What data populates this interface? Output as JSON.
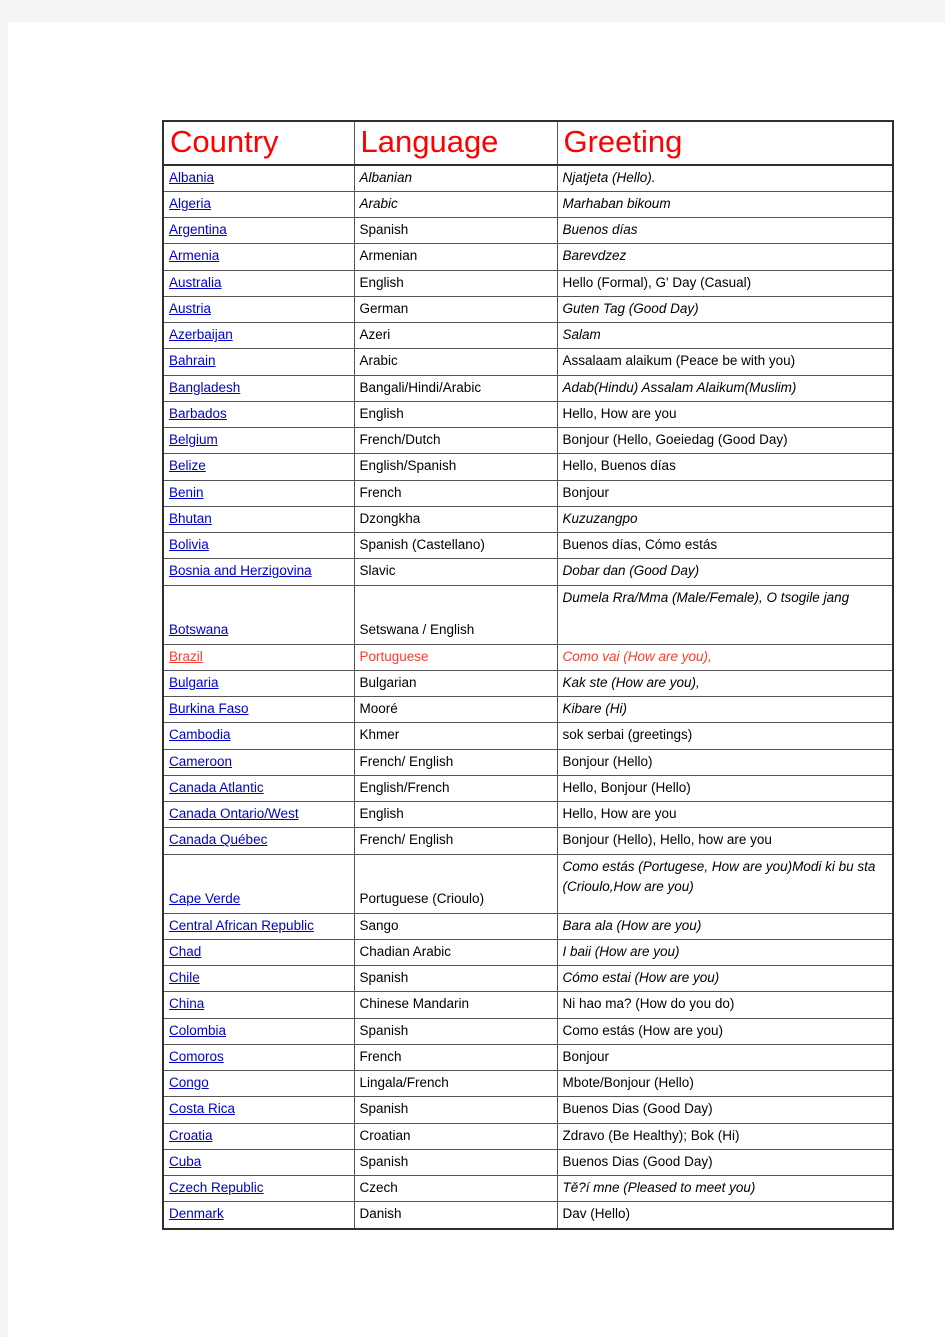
{
  "document": {
    "table": {
      "headers": {
        "country": "Country",
        "language": "Language",
        "greeting": "Greeting"
      },
      "header_color": "#ff0000",
      "link_color": "#0000cc",
      "highlight_color": "#ff3b30",
      "rows": [
        {
          "country": "Albania",
          "language": "Albanian",
          "greeting": "Njatjeta (Hello).",
          "language_italic": true,
          "greeting_italic": true,
          "highlight": false
        },
        {
          "country": "Algeria",
          "language": "Arabic",
          "greeting": "Marhaban bikoum",
          "language_italic": true,
          "greeting_italic": true,
          "highlight": false
        },
        {
          "country": "Argentina",
          "language": "Spanish",
          "greeting": "Buenos días",
          "language_italic": false,
          "greeting_italic": true,
          "highlight": false
        },
        {
          "country": "Armenia",
          "language": "Armenian",
          "greeting": "Barevdzez",
          "language_italic": false,
          "greeting_italic": true,
          "highlight": false
        },
        {
          "country": "Australia",
          "language": "English",
          "greeting": "Hello (Formal), G' Day (Casual)",
          "language_italic": false,
          "greeting_italic": false,
          "highlight": false
        },
        {
          "country": "Austria",
          "language": "German",
          "greeting": "Guten Tag (Good Day)",
          "language_italic": false,
          "greeting_italic": true,
          "highlight": false
        },
        {
          "country": "Azerbaijan",
          "language": "Azeri",
          "greeting": "Salam",
          "language_italic": false,
          "greeting_italic": true,
          "highlight": false
        },
        {
          "country": "Bahrain",
          "language": "Arabic",
          "greeting": "Assalaam alaikum (Peace be with you)",
          "language_italic": false,
          "greeting_italic": false,
          "highlight": false
        },
        {
          "country": "Bangladesh",
          "language": "Bangali/Hindi/Arabic",
          "greeting": "Adab(Hindu) Assalam Alaikum(Muslim)",
          "language_italic": false,
          "greeting_italic": true,
          "highlight": false
        },
        {
          "country": "Barbados",
          "language": "English",
          "greeting": "Hello, How are you",
          "language_italic": false,
          "greeting_italic": false,
          "highlight": false
        },
        {
          "country": "Belgium",
          "language": "French/Dutch",
          "greeting": "Bonjour (Hello, Goeiedag (Good Day)",
          "language_italic": false,
          "greeting_italic": false,
          "highlight": false
        },
        {
          "country": "Belize",
          "language": "English/Spanish",
          "greeting": "Hello, Buenos días",
          "language_italic": false,
          "greeting_italic": false,
          "highlight": false
        },
        {
          "country": "Benin",
          "language": "French",
          "greeting": "Bonjour",
          "language_italic": false,
          "greeting_italic": false,
          "highlight": false
        },
        {
          "country": "Bhutan",
          "language": "Dzongkha",
          "greeting": "Kuzuzangpo",
          "language_italic": false,
          "greeting_italic": true,
          "highlight": false
        },
        {
          "country": "Bolivia",
          "language": "Spanish (Castellano)",
          "greeting": "Buenos días, Cómo estás",
          "language_italic": false,
          "greeting_italic": false,
          "highlight": false
        },
        {
          "country": "Bosnia and Herzigovina",
          "language": "Slavic",
          "greeting": "Dobar dan (Good Day)",
          "language_italic": false,
          "greeting_italic": true,
          "highlight": false
        },
        {
          "country": "Botswana",
          "language": "Setswana / English",
          "greeting": "Dumela Rra/Mma (Male/Female), O tsogile jang",
          "language_italic": false,
          "greeting_italic": true,
          "highlight": false,
          "tall": true
        },
        {
          "country": "Brazil",
          "language": "Portuguese",
          "greeting": "Como vai (How are you),",
          "language_italic": false,
          "greeting_italic": true,
          "highlight": true
        },
        {
          "country": "Bulgaria",
          "language": "Bulgarian",
          "greeting": "Kak ste (How are you),",
          "language_italic": false,
          "greeting_italic": true,
          "highlight": false
        },
        {
          "country": "Burkina Faso",
          "language": "Mooré",
          "greeting": "Kibare (Hi)",
          "language_italic": false,
          "greeting_italic": true,
          "highlight": false
        },
        {
          "country": "Cambodia",
          "language": "Khmer",
          "greeting": "sok serbai (greetings)",
          "language_italic": false,
          "greeting_italic": false,
          "highlight": false
        },
        {
          "country": "Cameroon",
          "language": "French/ English",
          "greeting": "Bonjour (Hello)",
          "language_italic": false,
          "greeting_italic": false,
          "highlight": false
        },
        {
          "country": "Canada Atlantic",
          "language": "English/French",
          "greeting": "Hello, Bonjour (Hello)",
          "language_italic": false,
          "greeting_italic": false,
          "highlight": false
        },
        {
          "country": "Canada Ontario/West",
          "language": "English",
          "greeting": "Hello, How are you",
          "language_italic": false,
          "greeting_italic": false,
          "highlight": false
        },
        {
          "country": "Canada Québec",
          "language": "French/ English",
          "greeting": "Bonjour (Hello), Hello, how are you",
          "language_italic": false,
          "greeting_italic": false,
          "highlight": false
        },
        {
          "country": "Cape Verde",
          "language": "Portuguese (Crioulo)",
          "greeting": "Como estás (Portugese, How are you)Modi ki bu sta (Crioulo,How are you)",
          "language_italic": false,
          "greeting_italic": true,
          "highlight": false,
          "tall": true
        },
        {
          "country": "Central African Republic",
          "language": "Sango",
          "greeting": "Bara ala (How are you)",
          "language_italic": false,
          "greeting_italic": true,
          "highlight": false
        },
        {
          "country": "Chad",
          "language": "Chadian Arabic",
          "greeting": "I baii (How are you)",
          "language_italic": false,
          "greeting_italic": true,
          "highlight": false
        },
        {
          "country": "Chile",
          "language": "Spanish",
          "greeting": "Cómo estai (How are you)",
          "language_italic": false,
          "greeting_italic": true,
          "highlight": false
        },
        {
          "country": "China",
          "language": "Chinese Mandarin",
          "greeting": "Ni hao ma? (How do you do)",
          "language_italic": false,
          "greeting_italic": false,
          "highlight": false
        },
        {
          "country": "Colombia",
          "language": "Spanish",
          "greeting": "Como estás (How are you)",
          "language_italic": false,
          "greeting_italic": false,
          "highlight": false
        },
        {
          "country": "Comoros",
          "language": "French",
          "greeting": "Bonjour",
          "language_italic": false,
          "greeting_italic": false,
          "highlight": false
        },
        {
          "country": "Congo",
          "language": "Lingala/French",
          "greeting": "Mbote/Bonjour (Hello)",
          "language_italic": false,
          "greeting_italic": false,
          "highlight": false
        },
        {
          "country": "Costa Rica   ",
          "language": "Spanish",
          "greeting": "Buenos Dias (Good Day)",
          "language_italic": false,
          "greeting_italic": false,
          "highlight": false
        },
        {
          "country": "Croatia   ",
          "language": "Croatian",
          "greeting": "Zdravo (Be Healthy); Bok (Hi)",
          "language_italic": false,
          "greeting_italic": false,
          "highlight": false
        },
        {
          "country": "Cuba",
          "language": "Spanish",
          "greeting": "Buenos Dias (Good Day)",
          "language_italic": false,
          "greeting_italic": false,
          "highlight": false
        },
        {
          "country": "Czech Republic",
          "language": "Czech",
          "greeting": "Tě?í mne (Pleased to meet you)",
          "language_italic": false,
          "greeting_italic": true,
          "highlight": false
        },
        {
          "country": "Denmark",
          "language": "Danish",
          "greeting": "Dav (Hello)",
          "language_italic": false,
          "greeting_italic": false,
          "highlight": false
        }
      ]
    }
  }
}
